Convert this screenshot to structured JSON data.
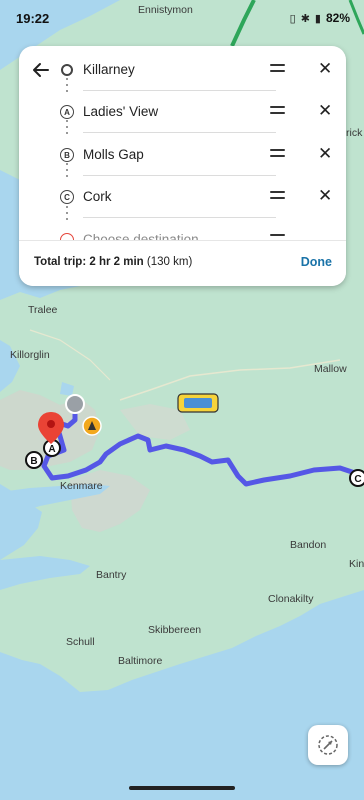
{
  "status_bar": {
    "time": "19:22",
    "battery": "82%",
    "icons": [
      "vibrate-icon",
      "bluetooth-icon",
      "signal-icon",
      "battery-icon"
    ]
  },
  "route": {
    "stops": [
      {
        "marker": "",
        "label": "Killarney",
        "type": "origin"
      },
      {
        "marker": "A",
        "label": "Ladies' View",
        "type": "waypoint"
      },
      {
        "marker": "B",
        "label": "Molls Gap",
        "type": "waypoint"
      },
      {
        "marker": "C",
        "label": "Cork",
        "type": "waypoint"
      },
      {
        "marker": "",
        "label": "Choose destination",
        "type": "destination"
      }
    ],
    "total_label": "Total trip:",
    "total_time": "2 hr 2 min",
    "total_distance": "(130 km)",
    "done_label": "Done"
  },
  "map": {
    "places": [
      "Ennistymon",
      "Tralee",
      "Killorglin",
      "Mallow",
      "Kenmare",
      "Bandon",
      "Bantry",
      "Clonakilty",
      "Skibbereen",
      "Schull",
      "Baltimore",
      "Kin",
      "rick"
    ],
    "waypoint_labels": [
      "A",
      "B",
      "C"
    ],
    "colors": {
      "route": "#5557e6",
      "water": "#a9d6ee",
      "land": "#bfe3cf",
      "highway": "#2ea65a",
      "pin": "#ea4335"
    }
  }
}
